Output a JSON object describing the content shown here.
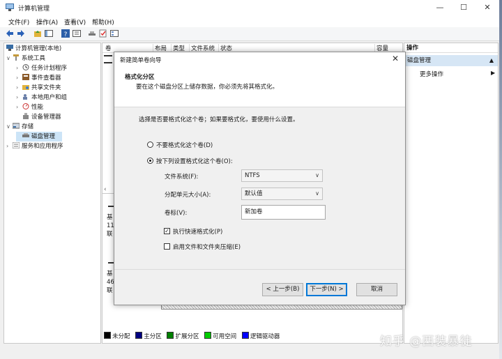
{
  "window": {
    "title": "计算机管理",
    "btn_min": "—",
    "btn_max": "☐",
    "btn_close": "✕"
  },
  "menu": [
    "文件(F)",
    "操作(A)",
    "查看(V)",
    "帮助(H)"
  ],
  "tree": {
    "root": "计算机管理(本地)",
    "system_tools": "系统工具",
    "task_scheduler": "任务计划程序",
    "event_viewer": "事件查看器",
    "shared_folders": "共享文件夹",
    "local_users": "本地用户和组",
    "performance": "性能",
    "device_manager": "设备管理器",
    "storage": "存储",
    "disk_management": "磁盘管理",
    "services_apps": "服务和应用程序"
  },
  "center": {
    "columns": [
      "卷",
      "布局",
      "类型",
      "文件系统",
      "状态",
      "容量"
    ],
    "disk0_text": [
      "基",
      "11",
      "联"
    ],
    "disk1_text": [
      "基",
      "46",
      "联"
    ]
  },
  "legend": [
    {
      "label": "未分配",
      "color": "#000000"
    },
    {
      "label": "主分区",
      "color": "#000080"
    },
    {
      "label": "扩展分区",
      "color": "#008000"
    },
    {
      "label": "可用空间",
      "color": "#00cc00"
    },
    {
      "label": "逻辑驱动器",
      "color": "#0000ff"
    }
  ],
  "actions": {
    "header": "操作",
    "disk_management": "磁盘管理",
    "more": "更多操作"
  },
  "dialog": {
    "title": "新建简单卷向导",
    "close": "✕",
    "head_title": "格式化分区",
    "head_desc": "要在这个磁盘分区上储存数据，你必须先将其格式化。",
    "prompt": "选择是否要格式化这个卷；如果要格式化，要使用什么设置。",
    "radio_no_format": "不要格式化这个卷(D)",
    "radio_format": "按下列设置格式化这个卷(O):",
    "fs_label": "文件系统(F):",
    "fs_value": "NTFS",
    "alloc_label": "分配单元大小(A):",
    "alloc_value": "默认值",
    "vol_label": "卷标(V):",
    "vol_value": "新加卷",
    "quick_format": "执行快速格式化(P)",
    "compression": "启用文件和文件夹压缩(E)",
    "back": "< 上一步(B)",
    "next": "下一步(N) >",
    "cancel": "取消"
  },
  "watermark": "知乎 @西装暴徒"
}
